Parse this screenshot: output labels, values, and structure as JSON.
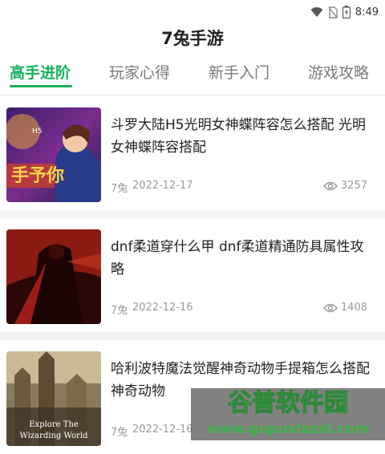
{
  "status": {
    "time": "8:49",
    "icons": [
      "wifi-icon",
      "no-sim-icon",
      "battery-icon"
    ]
  },
  "app": {
    "title": "7兔手游"
  },
  "tabs": [
    {
      "label": "高手进阶",
      "active": true
    },
    {
      "label": "玩家心得",
      "active": false
    },
    {
      "label": "新手入门",
      "active": false
    },
    {
      "label": "游戏攻略",
      "active": false
    }
  ],
  "articles": [
    {
      "title": "斗罗大陆H5光明女神蝶阵容怎么搭配 光明女神蝶阵容搭配",
      "author": "7兔",
      "date": "2022-12-17",
      "views": "3257",
      "thumb_text": "H5"
    },
    {
      "title": "dnf柔道穿什么甲 dnf柔道精通防具属性攻略",
      "author": "7兔",
      "date": "2022-12-16",
      "views": "1408"
    },
    {
      "title": "哈利波特魔法觉醒神奇动物手提箱怎么搭配 神奇动物",
      "author": "7兔",
      "date": "2022-12-16",
      "thumb_text_1": "Explore The",
      "thumb_text_2": "Wizarding World"
    }
  ],
  "watermark": {
    "title": "谷普软件园",
    "url": "www.gupuxlazal.com"
  },
  "colors": {
    "accent": "#13b15e",
    "meta": "#999999"
  }
}
